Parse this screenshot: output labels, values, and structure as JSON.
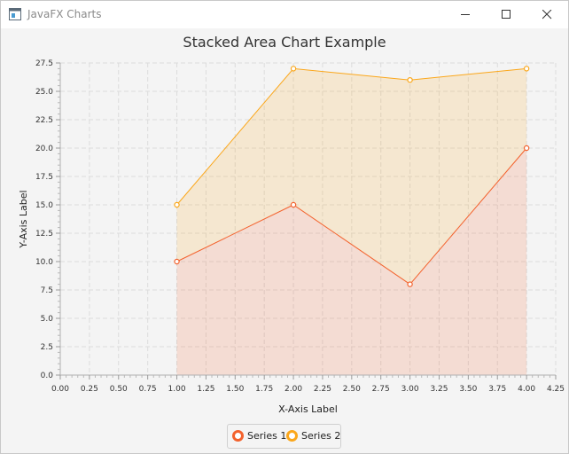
{
  "window": {
    "title": "JavaFX Charts"
  },
  "chart_data": {
    "type": "area",
    "stacked": true,
    "title": "Stacked Area Chart Example",
    "xlabel": "X-Axis Label",
    "ylabel": "Y-Axis Label",
    "xlim": [
      0,
      4.25
    ],
    "ylim": [
      0,
      27.5
    ],
    "x_tick_step": 0.25,
    "y_tick_step": 2.5,
    "x_tick_labels": [
      "0.00",
      "0.25",
      "0.50",
      "0.75",
      "1.00",
      "1.25",
      "1.50",
      "1.75",
      "2.00",
      "2.25",
      "2.50",
      "2.75",
      "3.00",
      "3.25",
      "3.50",
      "3.75",
      "4.00",
      "4.25"
    ],
    "y_tick_labels": [
      "0.0",
      "2.5",
      "5.0",
      "7.5",
      "10.0",
      "12.5",
      "15.0",
      "17.5",
      "20.0",
      "22.5",
      "25.0",
      "27.5"
    ],
    "grid": true,
    "legend_position": "bottom",
    "series": [
      {
        "name": "Series 1",
        "color": "#f3622d",
        "x": [
          1,
          2,
          3,
          4
        ],
        "values": [
          10,
          15,
          8,
          20
        ]
      },
      {
        "name": "Series 2",
        "color": "#fba71b",
        "x": [
          1,
          2,
          3,
          4
        ],
        "values": [
          5,
          12,
          18,
          7
        ]
      }
    ]
  }
}
